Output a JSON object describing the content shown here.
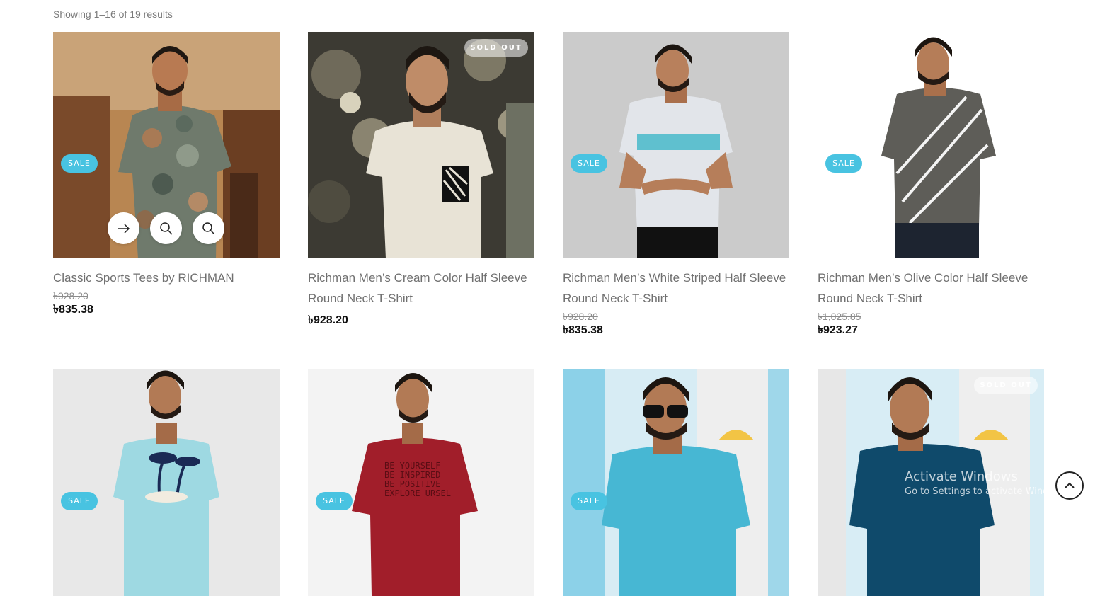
{
  "result_count": "Showing 1–16 of 19 results",
  "labels": {
    "sale": "SALE",
    "sold_out": "SOLD OUT"
  },
  "icons": {
    "next": "arrow-right-icon",
    "quick_view": "search-icon",
    "zoom": "search-icon",
    "scroll_top": "chevron-up-icon"
  },
  "colors": {
    "sale_badge": "#48c3e1",
    "title": "#707070",
    "price": "#111111"
  },
  "products": [
    {
      "title": "Classic Sports Tees by RICHMAN",
      "old_price": "৳928.20",
      "price": "৳835.38"
    },
    {
      "title": "Richman Men’s Cream Color Half Sleeve Round Neck T-Shirt",
      "old_price": "",
      "price": "৳928.20"
    },
    {
      "title": "Richman Men’s White Striped Half Sleeve Round Neck T-Shirt",
      "old_price": "৳928.20",
      "price": "৳835.38"
    },
    {
      "title": "Richman Men’s Olive Color Half Sleeve Round Neck T-Shirt",
      "old_price": "৳1,025.85",
      "price": "৳923.27"
    }
  ],
  "tshirt_prints": {
    "row2_col2": [
      "BE YOURSELF",
      "BE INSPIRED",
      "BE POSITIVE",
      "EXPLORE URSEL"
    ]
  },
  "watermark": {
    "line1": "Activate Windows",
    "line2": "Go to Settings to activate Windows."
  }
}
